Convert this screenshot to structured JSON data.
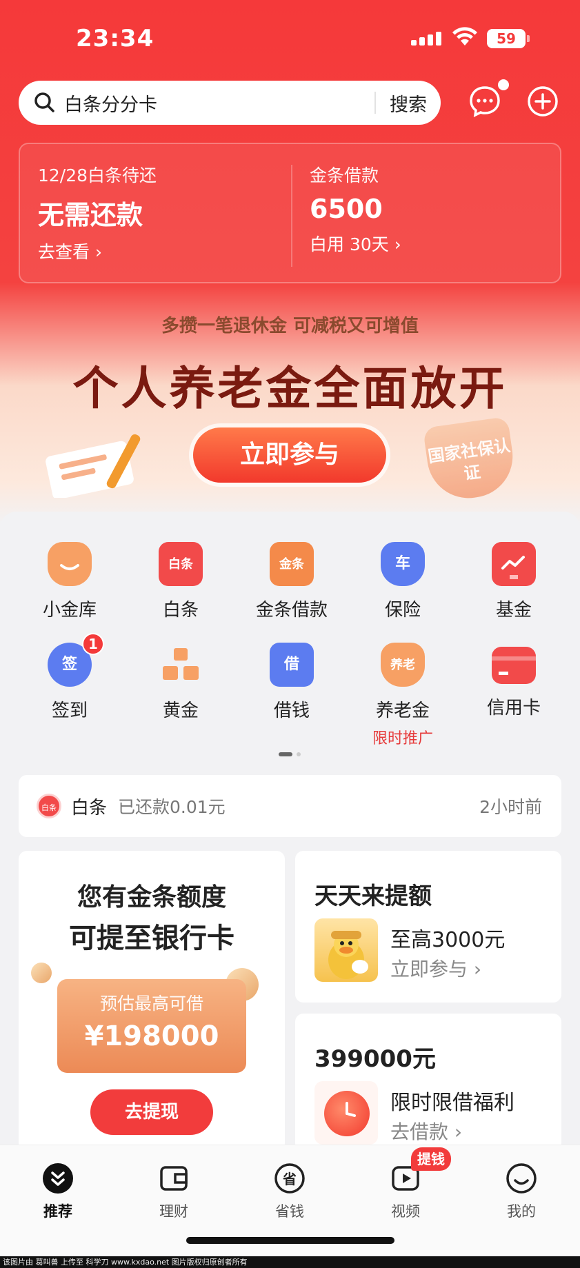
{
  "status": {
    "time": "23:34",
    "battery": "59"
  },
  "search": {
    "query": "白条分分卡",
    "button": "搜索"
  },
  "summary": {
    "left": {
      "label": "12/28白条待还",
      "value": "无需还款",
      "link": "去查看 ›"
    },
    "right": {
      "label": "金条借款",
      "value": "6500",
      "link": "白用 30天 ›"
    }
  },
  "banner": {
    "subtitle": "多攒一笔退休金 可减税又可增值",
    "title": "个人养老金全面放开",
    "button": "立即参与",
    "badge": "国家社保认证"
  },
  "grid": [
    {
      "label": "小金库",
      "icon": "money-bag-icon",
      "color": "#f7a064"
    },
    {
      "label": "白条",
      "icon": "baitiao-icon",
      "glyph": "白条",
      "color": "#f24a4a"
    },
    {
      "label": "金条借款",
      "icon": "jintiao-icon",
      "glyph": "金条",
      "color": "#f48a4a"
    },
    {
      "label": "保险",
      "icon": "car-shield-icon",
      "glyph": "车",
      "color": "#5c7cf0"
    },
    {
      "label": "基金",
      "icon": "chart-monitor-icon",
      "color": "#f24a4a"
    },
    {
      "label": "签到",
      "icon": "sign-in-icon",
      "glyph": "签",
      "color": "#5c7cf0",
      "badge": "1"
    },
    {
      "label": "黄金",
      "icon": "gold-bars-icon",
      "color": "#f7a064"
    },
    {
      "label": "借钱",
      "icon": "borrow-icon",
      "glyph": "借",
      "color": "#5c7cf0"
    },
    {
      "label": "养老金",
      "icon": "pension-icon",
      "glyph": "养老",
      "color": "#f7a064",
      "sub": "限时推广"
    },
    {
      "label": "信用卡",
      "icon": "credit-card-icon",
      "color": "#f24a4a"
    }
  ],
  "notice": {
    "icon_text": "白条",
    "title": "白条",
    "text": "已还款0.01元",
    "time": "2小时前"
  },
  "card_left": {
    "title1": "您有金条额度",
    "title2": "可提至银行卡",
    "box_label": "预估最高可借",
    "box_value": "¥198000",
    "button": "去提现"
  },
  "card_r1": {
    "title": "天天来提额",
    "line1": "至高3000元",
    "line2": "立即参与 ›"
  },
  "card_r2": {
    "title": "399000元",
    "line1": "限时限借福利",
    "line2": "去借款 ›"
  },
  "tabs": [
    {
      "label": "推荐",
      "icon": "double-chevron-icon"
    },
    {
      "label": "理财",
      "icon": "wallet-icon"
    },
    {
      "label": "省钱",
      "icon": "save-money-icon"
    },
    {
      "label": "视频",
      "icon": "video-icon"
    },
    {
      "label": "我的",
      "icon": "smile-icon"
    }
  ],
  "tab_badge": "提钱",
  "footer": "该图片由 葛叫兽 上传至 科学刀 www.kxdao.net 图片版权归原创者所有"
}
